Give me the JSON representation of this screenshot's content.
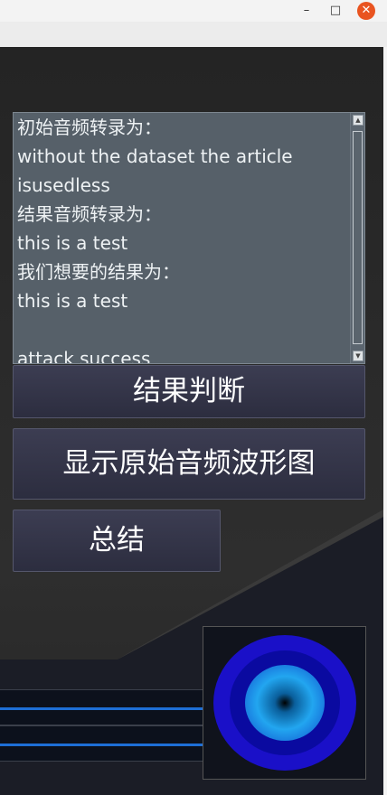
{
  "window": {
    "minimize_glyph": "–",
    "maximize_glyph": "□",
    "close_glyph": "✕"
  },
  "transcript": {
    "text": "初始音频转录为：\nwithout the dataset the article\nisusedless\n结果音频转录为：\nthis is a test\n我们想要的结果为：\nthis is a test\n\nattack success"
  },
  "buttons": {
    "judge_label": "结果判断",
    "waveform_label": "显示原始音频波形图",
    "summary_label": "总结"
  },
  "colors": {
    "accent_blue": "#1e6fd6",
    "button_bg": "#2c2d3f",
    "transcript_bg": "#566069",
    "close_button": "#e95420"
  }
}
